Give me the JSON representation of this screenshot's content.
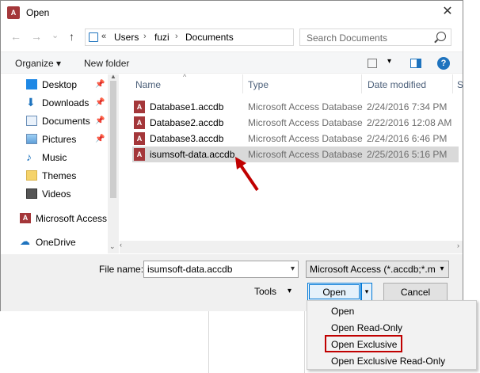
{
  "window": {
    "title": "Open",
    "app_icon": "A",
    "close_glyph": "✕"
  },
  "nav_buttons": {
    "back": "←",
    "forward": "→",
    "recent": "⌄",
    "up": "↑"
  },
  "address": {
    "overflow": "«",
    "crumbs": [
      "Users",
      "fuzi",
      "Documents"
    ],
    "separator": "›",
    "dropdown": "⌄",
    "refresh": "↻"
  },
  "search": {
    "placeholder": "Search Documents"
  },
  "commands": {
    "organize": "Organize ▾",
    "new_folder": "New folder",
    "view_dropdown": "▾",
    "help": "?"
  },
  "navigation": {
    "items": [
      {
        "label": "Desktop",
        "icon": "desktop-icon",
        "pinned": true
      },
      {
        "label": "Downloads",
        "icon": "download-icon",
        "pinned": true
      },
      {
        "label": "Documents",
        "icon": "documents-icon",
        "pinned": true
      },
      {
        "label": "Pictures",
        "icon": "pictures-icon",
        "pinned": true
      },
      {
        "label": "Music",
        "icon": "music-icon",
        "pinned": false
      },
      {
        "label": "Themes",
        "icon": "folder-icon",
        "pinned": false
      },
      {
        "label": "Videos",
        "icon": "videos-icon",
        "pinned": false
      },
      {
        "label": "Microsoft Access",
        "icon": "access-icon",
        "pinned": false
      },
      {
        "label": "OneDrive",
        "icon": "onedrive-icon",
        "pinned": false
      }
    ],
    "pin_glyph": "📌"
  },
  "columns": {
    "name": "Name",
    "type": "Type",
    "date": "Date modified",
    "size": "S"
  },
  "files": [
    {
      "name": "Database1.accdb",
      "type": "Microsoft Access Database",
      "date": "2/24/2016 7:34 PM",
      "selected": false
    },
    {
      "name": "Database2.accdb",
      "type": "Microsoft Access Database",
      "date": "2/22/2016 12:08 AM",
      "selected": false
    },
    {
      "name": "Database3.accdb",
      "type": "Microsoft Access Database",
      "date": "2/24/2016 6:46 PM",
      "selected": false
    },
    {
      "name": "isumsoft-data.accdb",
      "type": "Microsoft Access Database",
      "date": "2/25/2016 5:16 PM",
      "selected": true
    }
  ],
  "footer": {
    "file_name_label": "File name:",
    "file_name_value": "isumsoft-data.accdb",
    "filter_value": "Microsoft Access (*.accdb;*.mc",
    "tools_label": "Tools",
    "open_label": "Open",
    "cancel_label": "Cancel",
    "dropdown_glyph": "▾"
  },
  "open_menu": {
    "items": [
      "Open",
      "Open Read-Only",
      "Open Exclusive",
      "Open Exclusive Read-Only"
    ],
    "highlighted": "Open Exclusive"
  },
  "colors": {
    "access_red": "#a4373a",
    "accent_blue": "#0078d7",
    "annotation_red": "#c00000",
    "selection_gray": "#d9d9d9"
  }
}
